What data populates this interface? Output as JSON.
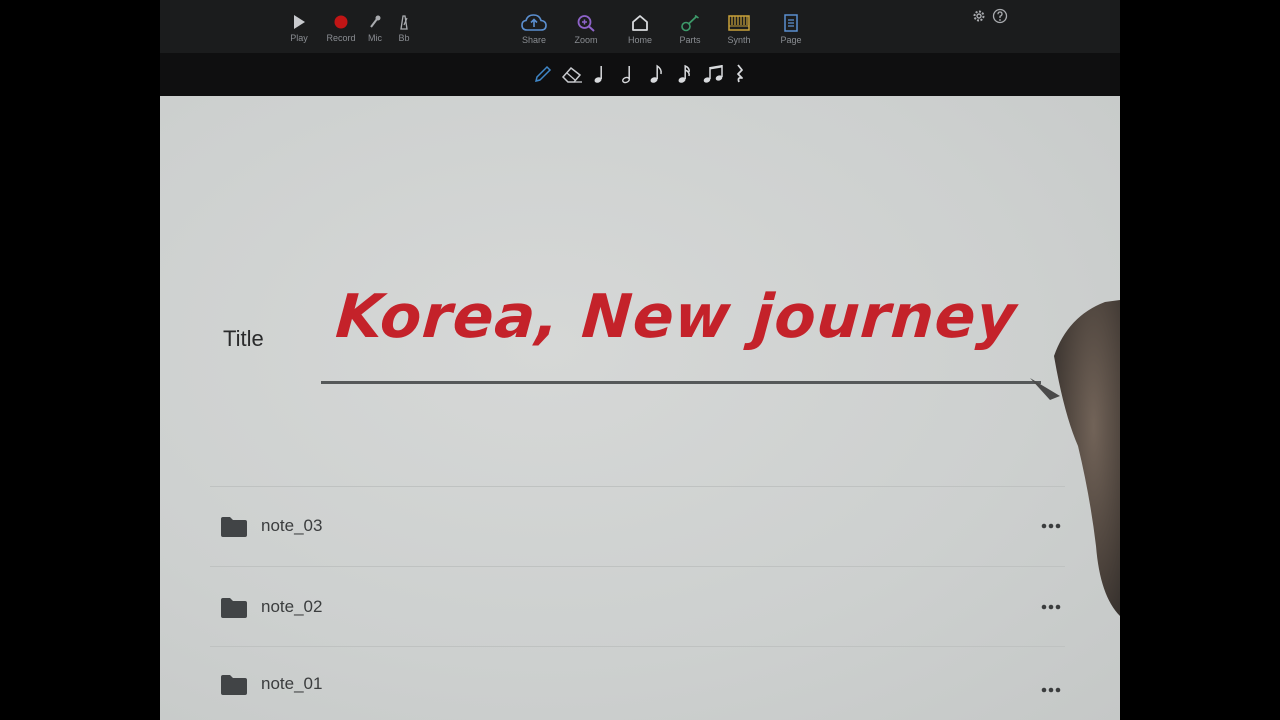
{
  "toolbar": {
    "left": [
      {
        "name": "play",
        "label": "Play",
        "icon": "play-icon"
      },
      {
        "name": "record",
        "label": "Record",
        "icon": "record-icon"
      },
      {
        "name": "mic",
        "label": "Mic",
        "icon": "mic-icon"
      },
      {
        "name": "metronome",
        "label": "Bb",
        "icon": "metronome-icon"
      }
    ],
    "center": [
      {
        "name": "share",
        "label": "Share",
        "icon": "cloud-upload-icon"
      },
      {
        "name": "zoom",
        "label": "Zoom",
        "icon": "zoom-icon"
      },
      {
        "name": "home",
        "label": "Home",
        "icon": "home-icon"
      },
      {
        "name": "parts",
        "label": "Parts",
        "icon": "guitar-icon"
      },
      {
        "name": "synth",
        "label": "Synth",
        "icon": "synth-icon"
      },
      {
        "name": "page",
        "label": "Page",
        "icon": "page-icon"
      }
    ],
    "right": [
      {
        "name": "settings",
        "icon": "gear-icon"
      },
      {
        "name": "help",
        "icon": "help-icon"
      }
    ]
  },
  "tools": [
    {
      "name": "pencil",
      "icon": "pencil-icon"
    },
    {
      "name": "eraser",
      "icon": "eraser-icon"
    },
    {
      "name": "quarter-note",
      "icon": "quarter-note-icon"
    },
    {
      "name": "half-note",
      "icon": "half-note-icon"
    },
    {
      "name": "eighth-note",
      "icon": "eighth-note-icon"
    },
    {
      "name": "sixteenth-note",
      "icon": "sixteenth-note-icon"
    },
    {
      "name": "beamed-notes",
      "icon": "beamed-notes-icon"
    },
    {
      "name": "rest",
      "icon": "rest-icon"
    }
  ],
  "document": {
    "title_label": "Title",
    "title_value": "Korea, New journey"
  },
  "notes": [
    {
      "name": "note_03"
    },
    {
      "name": "note_02"
    },
    {
      "name": "note_01"
    }
  ],
  "colors": {
    "toolbar_bg": "#1b1c1d",
    "tool_bg": "#0f0f10",
    "paper": "#cfd2d1",
    "title_red": "#c4222a",
    "record_red": "#c11515",
    "share_blue": "#5b8fd0",
    "zoom_purple": "#8e63c9",
    "parts_green": "#3d9a6a",
    "synth_gold": "#c9a23a",
    "tool_blue": "#3f86c7"
  }
}
